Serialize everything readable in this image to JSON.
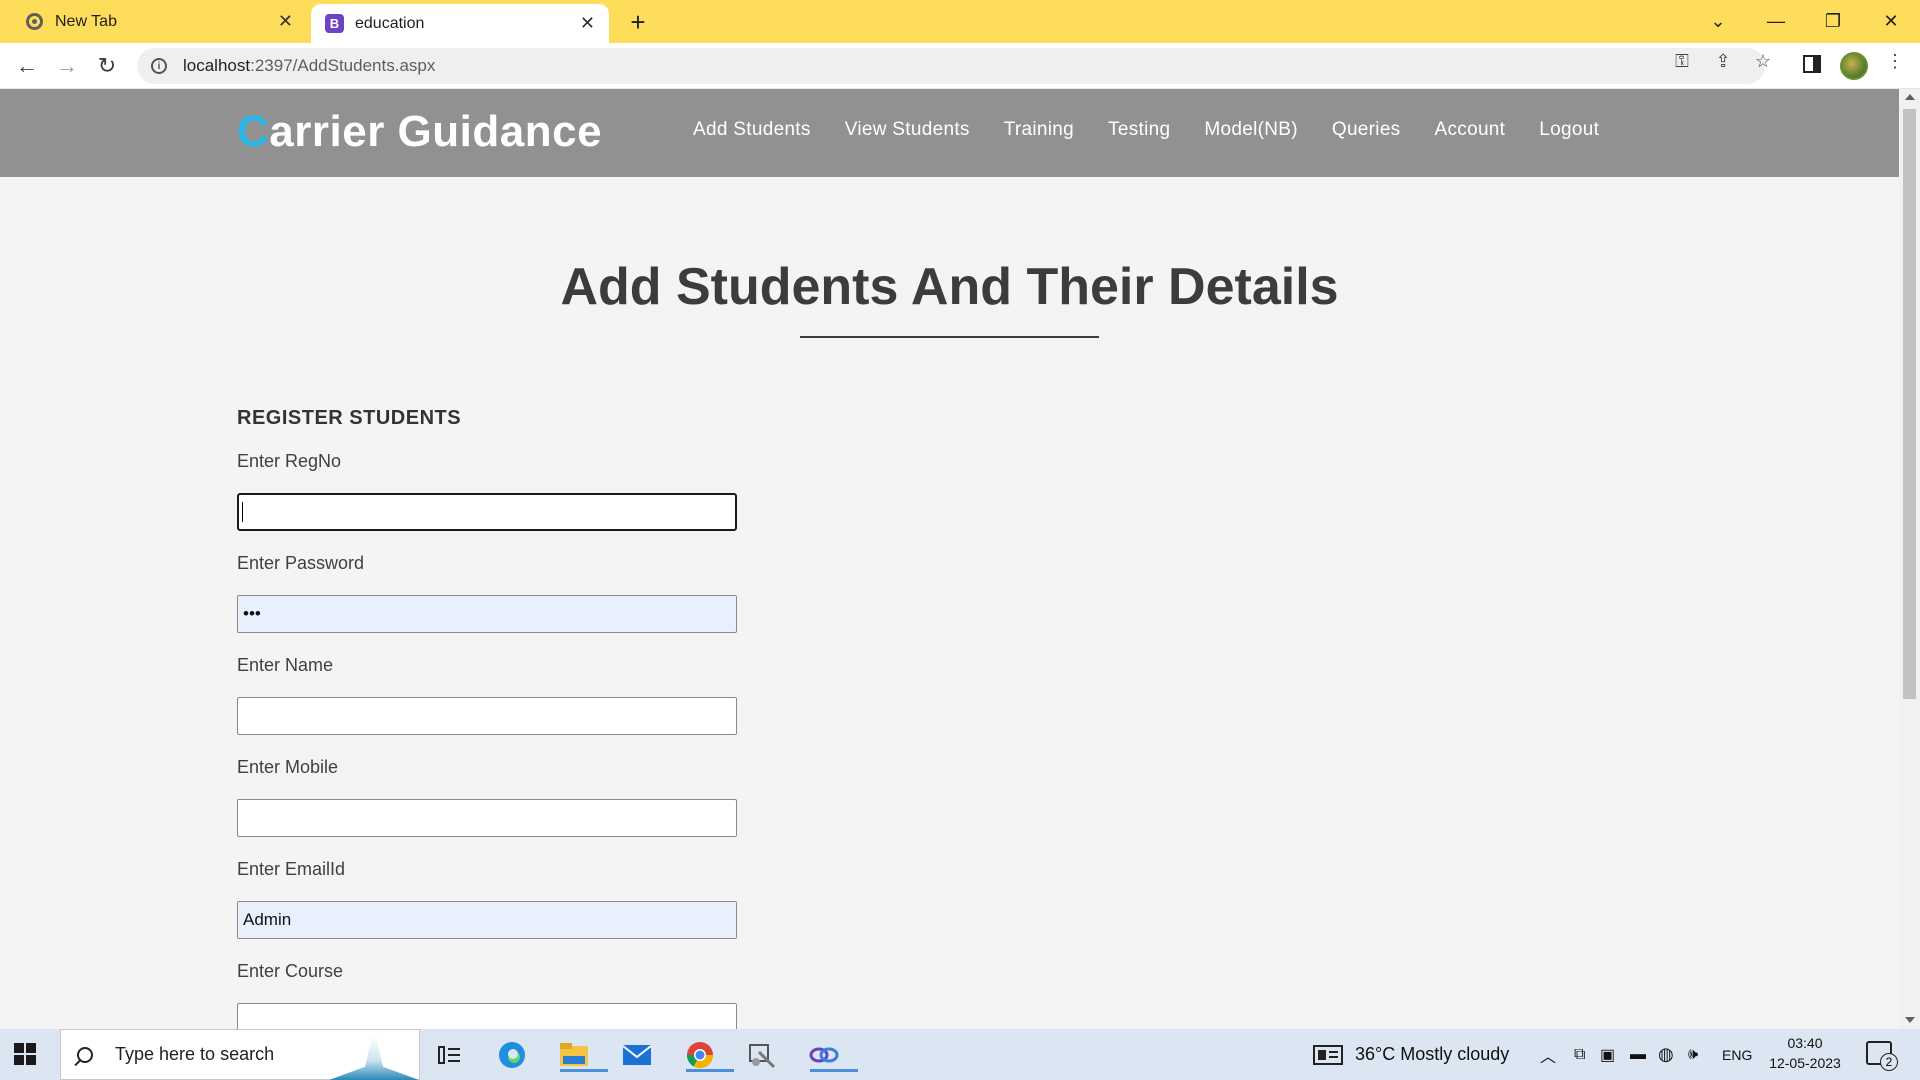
{
  "browser": {
    "tabs": [
      {
        "title": "New Tab",
        "active": false,
        "icon": "chrome-icon"
      },
      {
        "title": "education",
        "active": true,
        "icon": "bootstrap-icon"
      }
    ],
    "address": {
      "host": "localhost",
      "path": ":2397/AddStudents.aspx"
    }
  },
  "site": {
    "brand_first": "C",
    "brand_rest": "arrier Guidance",
    "brand_accent_color": "#29b6e8",
    "header_color": "#919191",
    "nav": [
      "Add Students",
      "View Students",
      "Training",
      "Testing",
      "Model(NB)",
      "Queries",
      "Account",
      "Logout"
    ]
  },
  "page": {
    "title": "Add Students And Their Details",
    "section_heading": "REGISTER STUDENTS",
    "fields": [
      {
        "label": "Enter RegNo",
        "value": "",
        "state": "focused"
      },
      {
        "label": "Enter Password",
        "value": "•••",
        "state": "autofill"
      },
      {
        "label": "Enter Name",
        "value": "",
        "state": "normal"
      },
      {
        "label": "Enter Mobile",
        "value": "",
        "state": "normal"
      },
      {
        "label": "Enter EmailId",
        "value": "Admin",
        "state": "autofill"
      },
      {
        "label": "Enter Course",
        "value": "",
        "state": "normal"
      }
    ]
  },
  "taskbar": {
    "search_placeholder": "Type here to search",
    "weather": "36°C  Mostly cloudy",
    "language": "ENG",
    "time": "03:40",
    "date": "12-05-2023",
    "notification_count": "2"
  }
}
